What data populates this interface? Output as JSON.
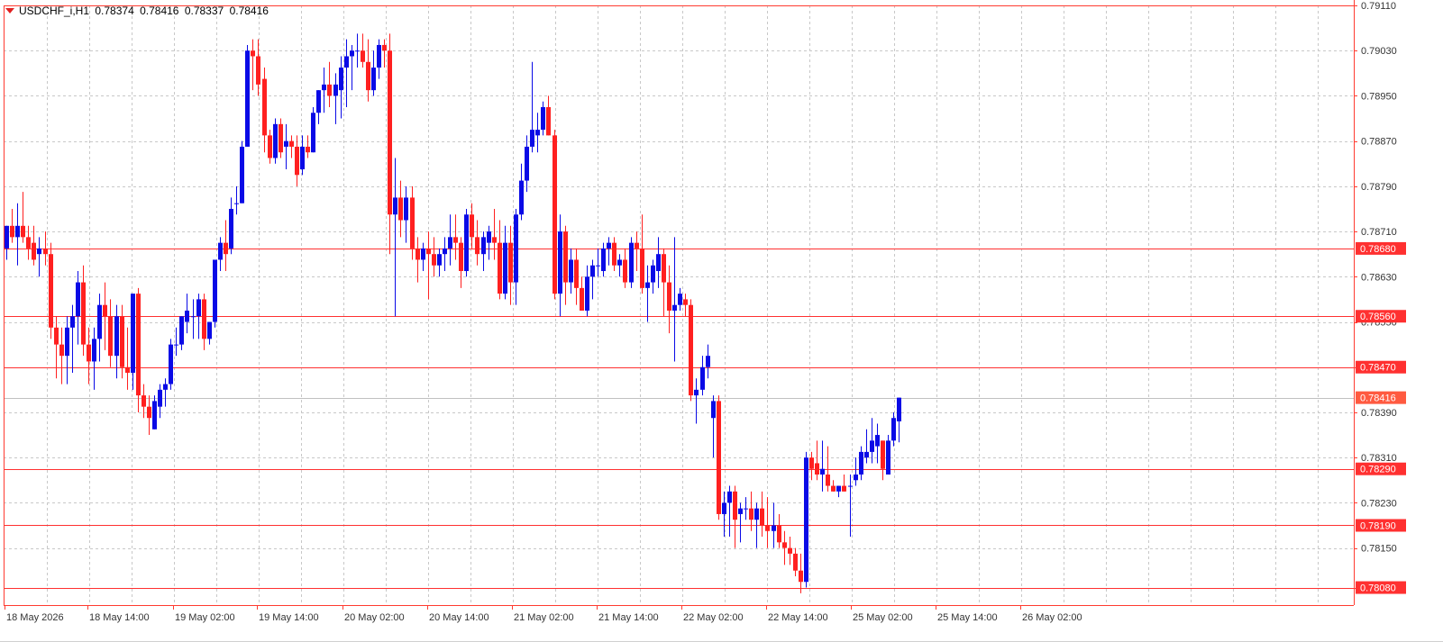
{
  "header": {
    "symbol": "USDCHF_i,H1",
    "open": "0.78374",
    "high": "0.78416",
    "low": "0.78337",
    "close": "0.78416"
  },
  "colors": {
    "bull": "#0a0ae6",
    "bear": "#ff2020",
    "grid": "#c8c8c8",
    "axis": "#ff3b30",
    "level": "#ff3030",
    "price_line": "#c0c0c0",
    "label_text": "#ffffff"
  },
  "chart_data": {
    "type": "candlestick",
    "instrument": "USDCHF_i",
    "timeframe": "H1",
    "ylim": [
      0.78049,
      0.7911
    ],
    "y_ticks": [
      "0.79110",
      "0.79030",
      "0.78950",
      "0.78870",
      "0.78790",
      "0.78710",
      "0.78630",
      "0.78550",
      "0.78470",
      "0.78390",
      "0.78310",
      "0.78230",
      "0.78150",
      "0.78080"
    ],
    "x_labels": [
      "18 May 2026",
      "18 May 14:00",
      "19 May 02:00",
      "19 May 14:00",
      "20 May 02:00",
      "20 May 14:00",
      "21 May 02:00",
      "21 May 14:00",
      "22 May 02:00",
      "22 May 14:00",
      "25 May 02:00",
      "25 May 14:00",
      "26 May 02:00"
    ],
    "grid": true,
    "horizontal_levels": [
      "0.78680",
      "0.78560",
      "0.78470",
      "0.78290",
      "0.78190",
      "0.78080"
    ],
    "current_price": "0.78416",
    "candles": [
      [
        0.7868,
        0.7872,
        0.7866,
        0.7872
      ],
      [
        0.7872,
        0.7875,
        0.7869,
        0.787
      ],
      [
        0.787,
        0.7876,
        0.7865,
        0.7872
      ],
      [
        0.7872,
        0.7878,
        0.7869,
        0.787
      ],
      [
        0.787,
        0.7872,
        0.7866,
        0.7868
      ],
      [
        0.7869,
        0.7872,
        0.7865,
        0.7866
      ],
      [
        0.7867,
        0.787,
        0.7863,
        0.7868
      ],
      [
        0.7868,
        0.7871,
        0.7865,
        0.7867
      ],
      [
        0.7867,
        0.7869,
        0.7852,
        0.7854
      ],
      [
        0.7854,
        0.7856,
        0.7845,
        0.7851
      ],
      [
        0.7851,
        0.7854,
        0.7844,
        0.7849
      ],
      [
        0.7849,
        0.7856,
        0.7844,
        0.7854
      ],
      [
        0.7854,
        0.7858,
        0.7846,
        0.7856
      ],
      [
        0.7856,
        0.7864,
        0.7851,
        0.7862
      ],
      [
        0.7862,
        0.7865,
        0.7849,
        0.7851
      ],
      [
        0.7851,
        0.7854,
        0.7844,
        0.7848
      ],
      [
        0.7848,
        0.7854,
        0.7843,
        0.7852
      ],
      [
        0.7852,
        0.786,
        0.7848,
        0.7858
      ],
      [
        0.7858,
        0.7862,
        0.785,
        0.7856
      ],
      [
        0.7856,
        0.7859,
        0.7847,
        0.7849
      ],
      [
        0.7849,
        0.7858,
        0.7845,
        0.7856
      ],
      [
        0.7856,
        0.7858,
        0.7845,
        0.7847
      ],
      [
        0.7847,
        0.7854,
        0.7843,
        0.7846
      ],
      [
        0.7846,
        0.786,
        0.7843,
        0.786
      ],
      [
        0.786,
        0.7861,
        0.7839,
        0.7842
      ],
      [
        0.7842,
        0.7844,
        0.7838,
        0.784
      ],
      [
        0.784,
        0.7842,
        0.7835,
        0.7838
      ],
      [
        0.7836,
        0.7842,
        0.7836,
        0.7841
      ],
      [
        0.784,
        0.7844,
        0.7838,
        0.7843
      ],
      [
        0.7843,
        0.7845,
        0.784,
        0.7844
      ],
      [
        0.7844,
        0.7852,
        0.7843,
        0.7851
      ],
      [
        0.7851,
        0.7854,
        0.7849,
        0.7851
      ],
      [
        0.7851,
        0.7856,
        0.785,
        0.7856
      ],
      [
        0.7855,
        0.786,
        0.7853,
        0.7857
      ],
      [
        0.7856,
        0.7859,
        0.7852,
        0.7856
      ],
      [
        0.7856,
        0.786,
        0.7852,
        0.7859
      ],
      [
        0.7859,
        0.786,
        0.785,
        0.7852
      ],
      [
        0.7852,
        0.7855,
        0.7851,
        0.7855
      ],
      [
        0.7855,
        0.7866,
        0.7854,
        0.7866
      ],
      [
        0.7866,
        0.787,
        0.7864,
        0.7869
      ],
      [
        0.7869,
        0.7873,
        0.7864,
        0.7867
      ],
      [
        0.7868,
        0.7877,
        0.7867,
        0.7875
      ],
      [
        0.7876,
        0.7879,
        0.7874,
        0.7876
      ],
      [
        0.7876,
        0.7887,
        0.7876,
        0.7886
      ],
      [
        0.7886,
        0.7904,
        0.7886,
        0.7903
      ],
      [
        0.7903,
        0.7905,
        0.7896,
        0.7902
      ],
      [
        0.7902,
        0.7905,
        0.7895,
        0.7897
      ],
      [
        0.7898,
        0.79,
        0.7885,
        0.7888
      ],
      [
        0.7888,
        0.7889,
        0.7883,
        0.7884
      ],
      [
        0.7884,
        0.7891,
        0.7883,
        0.789
      ],
      [
        0.789,
        0.7891,
        0.7884,
        0.7885
      ],
      [
        0.7886,
        0.789,
        0.7882,
        0.7887
      ],
      [
        0.7887,
        0.7888,
        0.7884,
        0.7886
      ],
      [
        0.7886,
        0.7888,
        0.7879,
        0.7881
      ],
      [
        0.7882,
        0.7888,
        0.7881,
        0.7886
      ],
      [
        0.7886,
        0.7888,
        0.7884,
        0.7885
      ],
      [
        0.7885,
        0.7893,
        0.7885,
        0.7892
      ],
      [
        0.7892,
        0.7896,
        0.789,
        0.7896
      ],
      [
        0.7896,
        0.79,
        0.7892,
        0.7897
      ],
      [
        0.7897,
        0.7901,
        0.7893,
        0.7895
      ],
      [
        0.7895,
        0.7899,
        0.789,
        0.7897
      ],
      [
        0.7896,
        0.7902,
        0.7891,
        0.79
      ],
      [
        0.79,
        0.7905,
        0.7893,
        0.7902
      ],
      [
        0.7902,
        0.7904,
        0.7896,
        0.7903
      ],
      [
        0.7903,
        0.7906,
        0.79,
        0.7903
      ],
      [
        0.7903,
        0.7906,
        0.79,
        0.7901
      ],
      [
        0.7901,
        0.7905,
        0.7894,
        0.7896
      ],
      [
        0.7896,
        0.7903,
        0.7895,
        0.79
      ],
      [
        0.79,
        0.7905,
        0.7898,
        0.7904
      ],
      [
        0.7904,
        0.7905,
        0.79,
        0.7903
      ],
      [
        0.7903,
        0.7906,
        0.7867,
        0.7874
      ],
      [
        0.7874,
        0.7884,
        0.7856,
        0.7877
      ],
      [
        0.7877,
        0.788,
        0.787,
        0.7873
      ],
      [
        0.7873,
        0.7879,
        0.7869,
        0.7877
      ],
      [
        0.7877,
        0.7879,
        0.7866,
        0.7868
      ],
      [
        0.7868,
        0.787,
        0.7862,
        0.7866
      ],
      [
        0.7866,
        0.7869,
        0.7864,
        0.7868
      ],
      [
        0.7868,
        0.7871,
        0.7859,
        0.7867
      ],
      [
        0.7867,
        0.787,
        0.7863,
        0.7865
      ],
      [
        0.7865,
        0.7868,
        0.7863,
        0.7867
      ],
      [
        0.7867,
        0.787,
        0.7864,
        0.7868
      ],
      [
        0.7868,
        0.7874,
        0.7865,
        0.787
      ],
      [
        0.787,
        0.7874,
        0.7866,
        0.7869
      ],
      [
        0.7869,
        0.787,
        0.7861,
        0.7864
      ],
      [
        0.7864,
        0.7875,
        0.7863,
        0.7874
      ],
      [
        0.7874,
        0.7876,
        0.7868,
        0.787
      ],
      [
        0.787,
        0.7873,
        0.7865,
        0.7867
      ],
      [
        0.7867,
        0.7871,
        0.7864,
        0.787
      ],
      [
        0.7869,
        0.7872,
        0.7866,
        0.7871
      ],
      [
        0.787,
        0.7875,
        0.7866,
        0.7869
      ],
      [
        0.7869,
        0.7873,
        0.7859,
        0.786
      ],
      [
        0.786,
        0.7872,
        0.7859,
        0.7869
      ],
      [
        0.7869,
        0.7872,
        0.7858,
        0.7862
      ],
      [
        0.7862,
        0.7875,
        0.7858,
        0.7874
      ],
      [
        0.7874,
        0.7883,
        0.7873,
        0.788
      ],
      [
        0.788,
        0.7888,
        0.7878,
        0.7886
      ],
      [
        0.7886,
        0.7901,
        0.7885,
        0.7889
      ],
      [
        0.7888,
        0.7892,
        0.7885,
        0.7889
      ],
      [
        0.7889,
        0.7894,
        0.7888,
        0.7893
      ],
      [
        0.7893,
        0.7895,
        0.7888,
        0.7888
      ],
      [
        0.7888,
        0.7889,
        0.7859,
        0.786
      ],
      [
        0.786,
        0.7874,
        0.7856,
        0.7871
      ],
      [
        0.7871,
        0.7872,
        0.7858,
        0.7862
      ],
      [
        0.7862,
        0.7868,
        0.786,
        0.7866
      ],
      [
        0.7866,
        0.7868,
        0.7858,
        0.7861
      ],
      [
        0.7861,
        0.7863,
        0.7857,
        0.7857
      ],
      [
        0.7857,
        0.7865,
        0.7856,
        0.7863
      ],
      [
        0.7863,
        0.7866,
        0.7859,
        0.7865
      ],
      [
        0.7865,
        0.7868,
        0.7863,
        0.7865
      ],
      [
        0.7864,
        0.7869,
        0.7863,
        0.7868
      ],
      [
        0.7868,
        0.787,
        0.7865,
        0.7869
      ],
      [
        0.7869,
        0.787,
        0.7864,
        0.7865
      ],
      [
        0.7865,
        0.7867,
        0.7863,
        0.7866
      ],
      [
        0.7866,
        0.7868,
        0.7861,
        0.7862
      ],
      [
        0.7862,
        0.787,
        0.7861,
        0.7869
      ],
      [
        0.7869,
        0.7871,
        0.7864,
        0.7868
      ],
      [
        0.7868,
        0.7874,
        0.786,
        0.7861
      ],
      [
        0.7861,
        0.7865,
        0.7855,
        0.7862
      ],
      [
        0.7862,
        0.7866,
        0.786,
        0.7865
      ],
      [
        0.7864,
        0.787,
        0.7861,
        0.7867
      ],
      [
        0.7867,
        0.7868,
        0.7856,
        0.7862
      ],
      [
        0.7862,
        0.7865,
        0.7853,
        0.7857
      ],
      [
        0.7857,
        0.787,
        0.7848,
        0.7858
      ],
      [
        0.7858,
        0.7861,
        0.7857,
        0.786
      ],
      [
        0.7859,
        0.786,
        0.7856,
        0.7858
      ],
      [
        0.7858,
        0.7859,
        0.7841,
        0.7842
      ],
      [
        0.7842,
        0.7845,
        0.7837,
        0.7843
      ],
      [
        0.7843,
        0.7849,
        0.7842,
        0.7847
      ],
      [
        0.7847,
        0.7851,
        0.7845,
        0.7849
      ],
      [
        0.7838,
        0.7842,
        0.7831,
        0.7841
      ],
      [
        0.7841,
        0.7842,
        0.782,
        0.7821
      ],
      [
        0.7821,
        0.7825,
        0.7817,
        0.7823
      ],
      [
        0.7823,
        0.7826,
        0.7817,
        0.7825
      ],
      [
        0.7825,
        0.7826,
        0.7815,
        0.782
      ],
      [
        0.7821,
        0.7823,
        0.7816,
        0.7822
      ],
      [
        0.7822,
        0.7824,
        0.782,
        0.7822
      ],
      [
        0.7822,
        0.7825,
        0.7818,
        0.782
      ],
      [
        0.782,
        0.7823,
        0.7815,
        0.7822
      ],
      [
        0.7822,
        0.7825,
        0.7817,
        0.7819
      ],
      [
        0.7819,
        0.7824,
        0.7815,
        0.7818
      ],
      [
        0.7818,
        0.7823,
        0.7815,
        0.7819
      ],
      [
        0.7819,
        0.7821,
        0.7815,
        0.7816
      ],
      [
        0.7816,
        0.7818,
        0.7812,
        0.7815
      ],
      [
        0.7815,
        0.7817,
        0.7812,
        0.7814
      ],
      [
        0.7814,
        0.7815,
        0.781,
        0.7811
      ],
      [
        0.7811,
        0.7814,
        0.7807,
        0.7809
      ],
      [
        0.7809,
        0.7832,
        0.7808,
        0.7831
      ],
      [
        0.7831,
        0.7832,
        0.7827,
        0.7829
      ],
      [
        0.783,
        0.7834,
        0.7827,
        0.7828
      ],
      [
        0.7828,
        0.7834,
        0.7825,
        0.7829
      ],
      [
        0.7828,
        0.7833,
        0.7825,
        0.7826
      ],
      [
        0.7826,
        0.7827,
        0.7825,
        0.7825
      ],
      [
        0.7825,
        0.7826,
        0.7824,
        0.7826
      ],
      [
        0.7826,
        0.7828,
        0.7825,
        0.7825
      ],
      [
        0.7826,
        0.7828,
        0.7817,
        0.7826
      ],
      [
        0.7827,
        0.7831,
        0.7826,
        0.7828
      ],
      [
        0.7828,
        0.7833,
        0.7827,
        0.7832
      ],
      [
        0.7831,
        0.7836,
        0.783,
        0.7832
      ],
      [
        0.7832,
        0.7838,
        0.783,
        0.7834
      ],
      [
        0.7833,
        0.7837,
        0.783,
        0.7835
      ],
      [
        0.7834,
        0.7834,
        0.7827,
        0.7829
      ],
      [
        0.7828,
        0.7835,
        0.7828,
        0.7834
      ],
      [
        0.7834,
        0.7839,
        0.7833,
        0.7838
      ],
      [
        0.78374,
        0.78416,
        0.78337,
        0.78416
      ]
    ]
  }
}
